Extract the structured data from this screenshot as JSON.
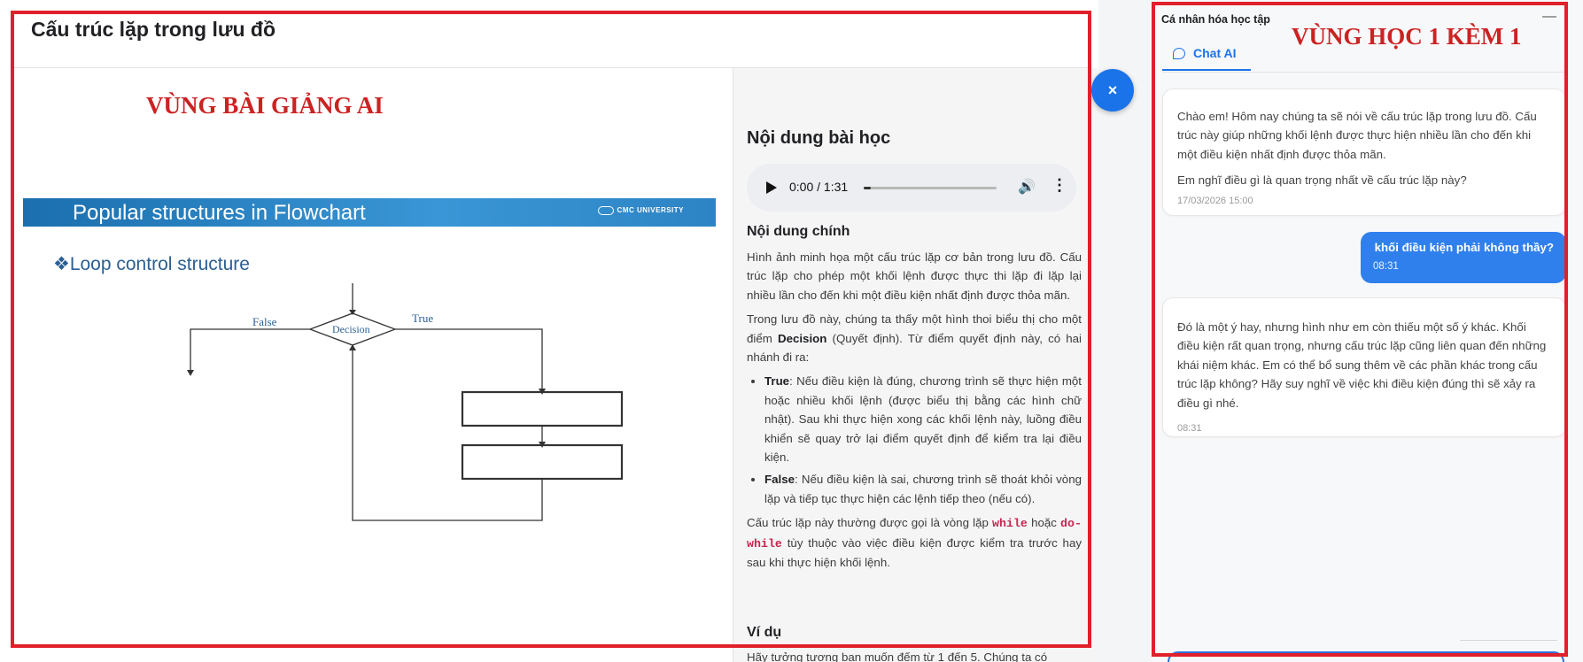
{
  "lesson": {
    "title": "Cấu trúc lặp trong lưu đồ",
    "region_label": "VÙNG BÀI GIẢNG AI"
  },
  "slide": {
    "banner_title": "Popular structures in Flowchart",
    "logo_text": "CMC UNIVERSITY",
    "bullet": "❖Loop control structure",
    "flow": {
      "false_label": "False",
      "decision_label": "Decision",
      "true_label": "True"
    }
  },
  "content": {
    "heading": "Nội dung bài học",
    "audio": {
      "time": "0:00 / 1:31",
      "progress": 0.05
    },
    "subheading": "Nội dung chính",
    "p1": "Hình ảnh minh họa một cấu trúc lặp cơ bản trong lưu đồ. Cấu trúc lặp cho phép một khối lệnh được thực thi lặp đi lặp lại nhiều lần cho đến khi một điều kiện nhất định được thỏa mãn.",
    "p2_a": "Trong lưu đồ này, chúng ta thấy một hình thoi biểu thị cho một điểm ",
    "p2_b": "Decision",
    "p2_c": " (Quyết định). Từ điểm quyết định này, có hai nhánh đi ra:",
    "li1_label": "True",
    "li1_text": ": Nếu điều kiện là đúng, chương trình sẽ thực hiện một hoặc nhiều khối lệnh (được biểu thị bằng các hình chữ nhật). Sau khi thực hiện xong các khối lệnh này, luồng điều khiển sẽ quay trở lại điểm quyết định để kiểm tra lại điều kiện.",
    "li2_label": "False",
    "li2_text": ": Nếu điều kiện là sai, chương trình sẽ thoát khỏi vòng lặp và tiếp tục thực hiện các lệnh tiếp theo (nếu có).",
    "p3_a": "Cấu trúc lặp này thường được gọi là vòng lặp ",
    "p3_code1": "while",
    "p3_b": " hoặc ",
    "p3_code2": "do-while",
    "p3_c": " tùy thuộc vào việc điều kiện được kiểm tra trước hay sau khi thực hiện khối lệnh.",
    "example_heading": "Ví dụ",
    "example_text": "Hãy tưởng tượng bạn muốn đếm từ 1 đến 5. Chúng ta có"
  },
  "close_button": "×",
  "panel": {
    "title": "Cá nhân hóa học tập",
    "minimize": "—",
    "tab_label": "Chat AI",
    "region_label": "VÙNG HỌC 1 KÈM 1",
    "messages": {
      "ai1_p1": "Chào em! Hôm nay chúng ta sẽ nói về cấu trúc lặp trong lưu đồ. Cấu trúc này giúp những khối lệnh được thực hiện nhiều lần cho đến khi một điều kiện nhất định được thỏa mãn.",
      "ai1_p2": "Em nghĩ điều gì là quan trọng nhất về cấu trúc lặp này?",
      "ai1_time": "17/03/2026 15:00",
      "user_text": "khối điều kiện phải không thầy?",
      "user_time": "08:31",
      "ai2_p1": "Đó là một ý hay, nhưng hình như em còn thiếu một số ý khác. Khối điều kiện rất quan trọng, nhưng cấu trúc lặp cũng liên quan đến những khái niệm khác. Em có thể bổ sung thêm về các phần khác trong cấu trúc lặp không? Hãy suy nghĩ về việc khi điều kiện đúng thì sẽ xảy ra điều gì nhé.",
      "ai2_time": "08:31"
    }
  },
  "colors": {
    "accent": "#1a73e8",
    "annotation_red": "#e0202a",
    "region_label": "#cc2222"
  }
}
